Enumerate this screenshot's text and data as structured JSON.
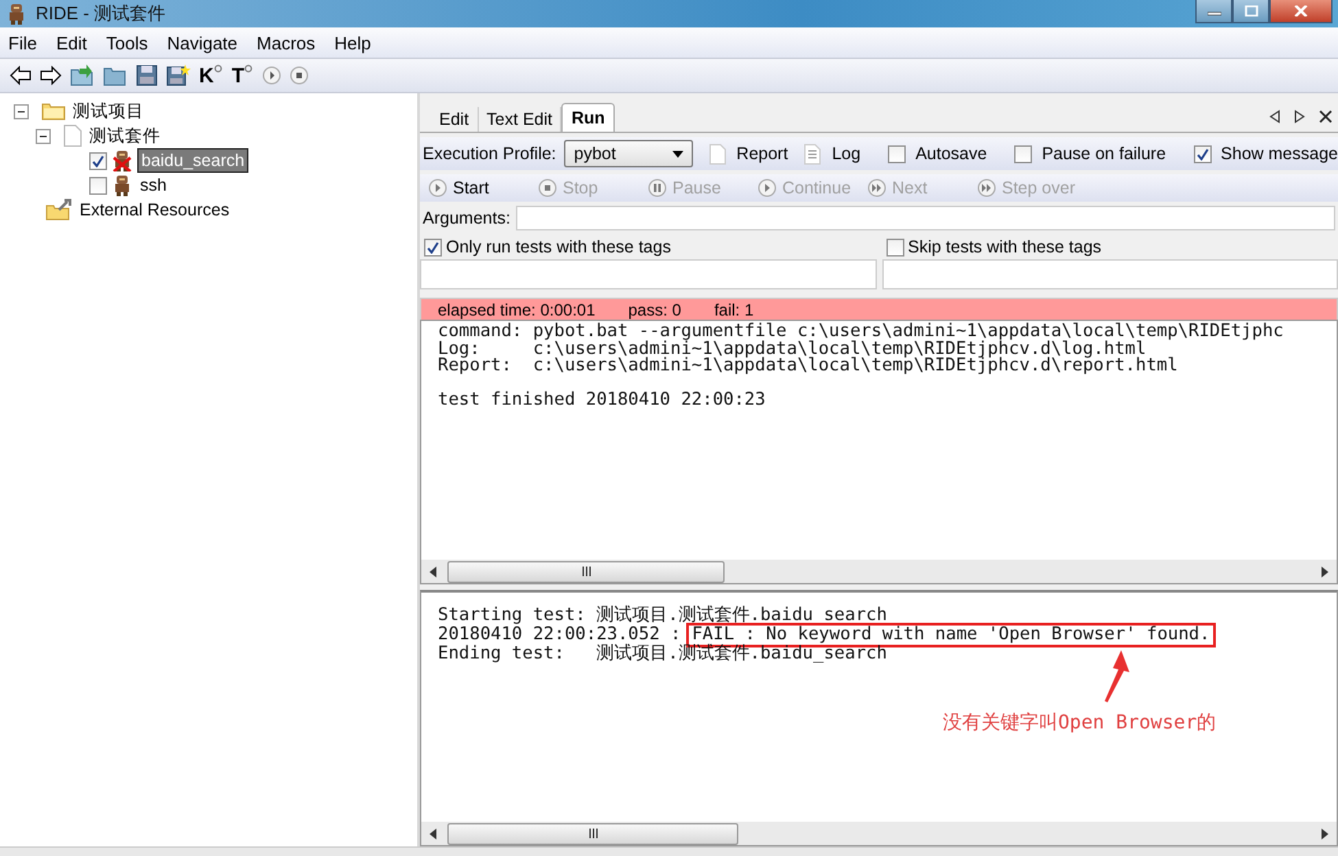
{
  "window": {
    "title": "RIDE - 测试套件"
  },
  "menu": [
    "File",
    "Edit",
    "Tools",
    "Navigate",
    "Macros",
    "Help"
  ],
  "toolbar": {
    "keyword_search_letter": "K",
    "test_search_letter": "T"
  },
  "tree": [
    {
      "label": "测试项目",
      "kind": "folder",
      "expanded": true,
      "selected": false,
      "children": [
        {
          "label": "测试套件",
          "kind": "suite",
          "expanded": true,
          "selected": false,
          "children": [
            {
              "label": "baidu_search",
              "kind": "test",
              "checked": true,
              "failed": true,
              "selected": true
            },
            {
              "label": "ssh",
              "kind": "test",
              "checked": false,
              "failed": false,
              "selected": false
            }
          ]
        }
      ]
    },
    {
      "label": "External Resources",
      "kind": "resource",
      "selected": false
    }
  ],
  "tabs": [
    {
      "label": "Edit",
      "selected": false
    },
    {
      "label": "Text Edit",
      "selected": false
    },
    {
      "label": "Run",
      "selected": true
    }
  ],
  "profile": {
    "label": "Execution Profile:",
    "value": "pybot",
    "report": "Report",
    "log": "Log",
    "options": [
      {
        "label": "Autosave",
        "checked": false
      },
      {
        "label": "Pause on failure",
        "checked": false
      },
      {
        "label": "Show message",
        "checked": true
      }
    ]
  },
  "run_buttons": [
    {
      "label": "Start",
      "kind": "play",
      "disabled": false
    },
    {
      "label": "Stop",
      "kind": "stop",
      "disabled": true
    },
    {
      "label": "Pause",
      "kind": "pause",
      "disabled": true
    },
    {
      "label": "Continue",
      "kind": "play",
      "disabled": true
    },
    {
      "label": "Next",
      "kind": "next",
      "disabled": true
    },
    {
      "label": "Step over",
      "kind": "next",
      "disabled": true
    }
  ],
  "arguments": {
    "label": "Arguments:"
  },
  "tag_filters": [
    {
      "label": "Only run tests with these tags",
      "checked": true
    },
    {
      "label": "Skip tests with these tags",
      "checked": false
    }
  ],
  "status": {
    "failed": true,
    "elapsed": "elapsed time: 0:00:01",
    "pass": "pass: 0",
    "fail": "fail: 1"
  },
  "output": [
    [
      "command: pybot.bat --argumentfile c:\\users\\admini~1\\appdata\\local\\temp\\RIDEtjphc",
      "Log:     c:\\users\\admini~1\\appdata\\local\\temp\\RIDEtjphcv.d\\log.html",
      "Report:  c:\\users\\admini~1\\appdata\\local\\temp\\RIDEtjphcv.d\\report.html"
    ],
    [
      "test finished 20180410 22:00:23"
    ]
  ],
  "messages": [
    {
      "text": "Starting test: 测试项目.测试套件.baidu_search",
      "highlighted": false
    },
    {
      "prefix": "20180410 22:00:23.052 :",
      "text": "FAIL : No keyword with name 'Open Browser' found.",
      "highlighted": true
    },
    {
      "text": "Ending test:   测试项目.测试套件.baidu_search",
      "highlighted": false
    }
  ],
  "annotation": {
    "text": "没有关键字叫Open Browser的"
  }
}
